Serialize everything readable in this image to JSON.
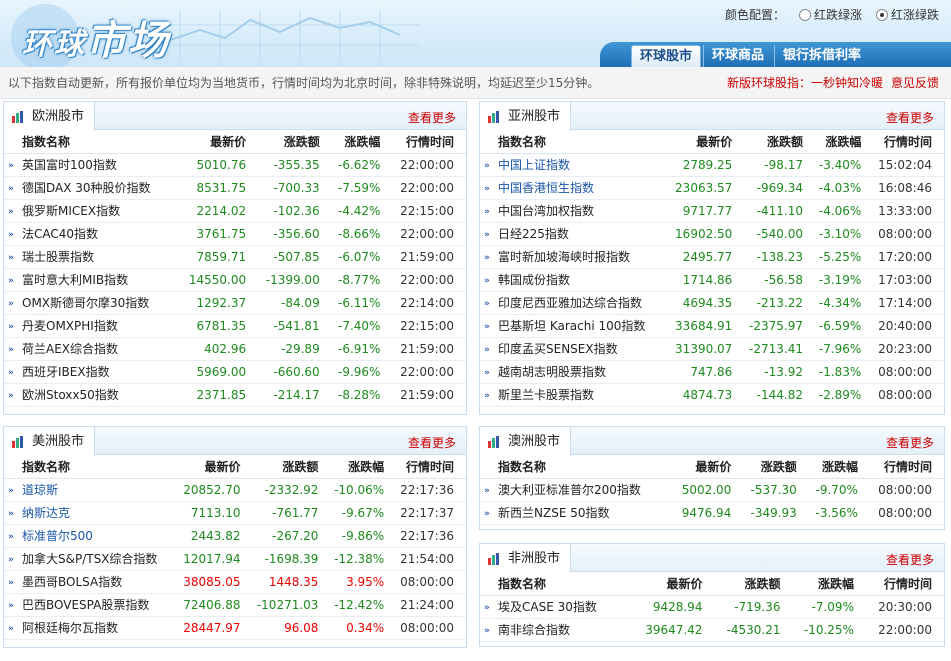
{
  "header": {
    "logo_part1": "环球",
    "logo_part2": "市场",
    "color_config_label": "颜色配置：",
    "option_red_down": "红跌绿涨",
    "option_red_up": "红涨绿跌",
    "tabs": [
      {
        "label": "环球股市"
      },
      {
        "label": "环球商品"
      },
      {
        "label": "银行拆借利率"
      }
    ]
  },
  "notice": {
    "text": "以下指数自动更新，所有报价单位均为当地货币，行情时间均为北京时间，除非特殊说明，均延迟至少15分钟。",
    "promo": "新版环球股指：一秒钟知冷暖",
    "feedback": "意见反馈"
  },
  "columns": {
    "name": "指数名称",
    "price": "最新价",
    "change": "涨跌额",
    "pct": "涨跌幅",
    "time": "行情时间"
  },
  "more_label": "查看更多",
  "colors": {
    "up": "#e00000",
    "down": "#1e8a1e",
    "accent": "#1f6fb6"
  },
  "panels": {
    "europe": {
      "title": "欧洲股市",
      "rows": [
        {
          "name": "英国富时100指数",
          "price": "5010.76",
          "change": "-355.35",
          "pct": "-6.62%",
          "time": "22:00:00"
        },
        {
          "name": "德国DAX 30种股价指数",
          "price": "8531.75",
          "change": "-700.33",
          "pct": "-7.59%",
          "time": "22:00:00"
        },
        {
          "name": "俄罗斯MICEX指数",
          "price": "2214.02",
          "change": "-102.36",
          "pct": "-4.42%",
          "time": "22:15:00"
        },
        {
          "name": "法CAC40指数",
          "price": "3761.75",
          "change": "-356.60",
          "pct": "-8.66%",
          "time": "22:00:00"
        },
        {
          "name": "瑞士股票指数",
          "price": "7859.71",
          "change": "-507.85",
          "pct": "-6.07%",
          "time": "21:59:00"
        },
        {
          "name": "富时意大利MIB指数",
          "price": "14550.00",
          "change": "-1399.00",
          "pct": "-8.77%",
          "time": "22:00:00"
        },
        {
          "name": "OMX斯德哥尔摩30指数",
          "price": "1292.37",
          "change": "-84.09",
          "pct": "-6.11%",
          "time": "22:14:00"
        },
        {
          "name": "丹麦OMXPHI指数",
          "price": "6781.35",
          "change": "-541.81",
          "pct": "-7.40%",
          "time": "22:15:00"
        },
        {
          "name": "荷兰AEX综合指数",
          "price": "402.96",
          "change": "-29.89",
          "pct": "-6.91%",
          "time": "21:59:00"
        },
        {
          "name": "西班牙IBEX指数",
          "price": "5969.00",
          "change": "-660.60",
          "pct": "-9.96%",
          "time": "22:00:00"
        },
        {
          "name": "欧洲Stoxx50指数",
          "price": "2371.85",
          "change": "-214.17",
          "pct": "-8.28%",
          "time": "21:59:00"
        }
      ]
    },
    "asia": {
      "title": "亚洲股市",
      "rows": [
        {
          "name": "中国上证指数",
          "price": "2789.25",
          "change": "-98.17",
          "pct": "-3.40%",
          "time": "15:02:04",
          "link": true
        },
        {
          "name": "中国香港恒生指数",
          "price": "23063.57",
          "change": "-969.34",
          "pct": "-4.03%",
          "time": "16:08:46",
          "link": true
        },
        {
          "name": "中国台湾加权指数",
          "price": "9717.77",
          "change": "-411.10",
          "pct": "-4.06%",
          "time": "13:33:00"
        },
        {
          "name": "日经225指数",
          "price": "16902.50",
          "change": "-540.00",
          "pct": "-3.10%",
          "time": "08:00:00"
        },
        {
          "name": "富时新加坡海峡时报指数",
          "price": "2495.77",
          "change": "-138.23",
          "pct": "-5.25%",
          "time": "17:20:00"
        },
        {
          "name": "韩国成份指数",
          "price": "1714.86",
          "change": "-56.58",
          "pct": "-3.19%",
          "time": "17:03:00"
        },
        {
          "name": "印度尼西亚雅加达综合指数",
          "price": "4694.35",
          "change": "-213.22",
          "pct": "-4.34%",
          "time": "17:14:00"
        },
        {
          "name": "巴基斯坦 Karachi 100指数",
          "price": "33684.91",
          "change": "-2375.97",
          "pct": "-6.59%",
          "time": "20:40:00"
        },
        {
          "name": "印度孟买SENSEX指数",
          "price": "31390.07",
          "change": "-2713.41",
          "pct": "-7.96%",
          "time": "20:23:00"
        },
        {
          "name": "越南胡志明股票指数",
          "price": "747.86",
          "change": "-13.92",
          "pct": "-1.83%",
          "time": "08:00:00"
        },
        {
          "name": "斯里兰卡股票指数",
          "price": "4874.73",
          "change": "-144.82",
          "pct": "-2.89%",
          "time": "08:00:00"
        }
      ]
    },
    "america": {
      "title": "美洲股市",
      "rows": [
        {
          "name": "道琼斯",
          "price": "20852.70",
          "change": "-2332.92",
          "pct": "-10.06%",
          "time": "22:17:36",
          "link": true
        },
        {
          "name": "纳斯达克",
          "price": "7113.10",
          "change": "-761.77",
          "pct": "-9.67%",
          "time": "22:17:37",
          "link": true
        },
        {
          "name": "标准普尔500",
          "price": "2443.82",
          "change": "-267.20",
          "pct": "-9.86%",
          "time": "22:17:36",
          "link": true
        },
        {
          "name": "加拿大S&P/TSX综合指数",
          "price": "12017.94",
          "change": "-1698.39",
          "pct": "-12.38%",
          "time": "21:54:00"
        },
        {
          "name": "墨西哥BOLSA指数",
          "price": "38085.05",
          "change": "1448.35",
          "pct": "3.95%",
          "time": "08:00:00"
        },
        {
          "name": "巴西BOVESPA股票指数",
          "price": "72406.88",
          "change": "-10271.03",
          "pct": "-12.42%",
          "time": "21:24:00"
        },
        {
          "name": "阿根廷梅尔瓦指数",
          "price": "28447.97",
          "change": "96.08",
          "pct": "0.34%",
          "time": "08:00:00"
        }
      ]
    },
    "australia": {
      "title": "澳洲股市",
      "rows": [
        {
          "name": "澳大利亚标准普尔200指数",
          "price": "5002.00",
          "change": "-537.30",
          "pct": "-9.70%",
          "time": "08:00:00"
        },
        {
          "name": "新西兰NZSE 50指数",
          "price": "9476.94",
          "change": "-349.93",
          "pct": "-3.56%",
          "time": "08:00:00"
        }
      ]
    },
    "africa": {
      "title": "非洲股市",
      "rows": [
        {
          "name": "埃及CASE 30指数",
          "price": "9428.94",
          "change": "-719.36",
          "pct": "-7.09%",
          "time": "20:30:00"
        },
        {
          "name": "南非综合指数",
          "price": "39647.42",
          "change": "-4530.21",
          "pct": "-10.25%",
          "time": "22:00:00"
        }
      ]
    }
  }
}
